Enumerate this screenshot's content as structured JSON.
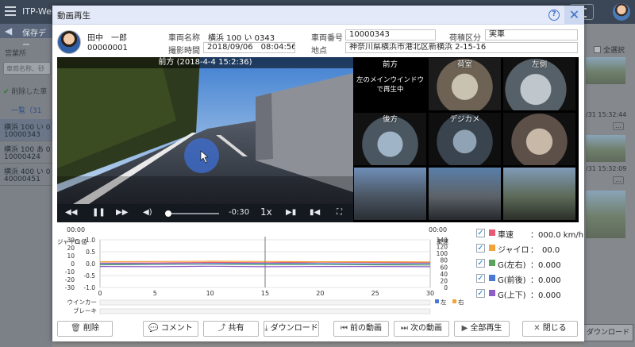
{
  "background": {
    "app_title": "ITP-Web",
    "breadcrumb": "保存デー",
    "office_label": "営業所",
    "search_placeholder": "車両名称、砂",
    "deleted_toggle": "削除した車",
    "list_header": "一覧（31",
    "list_items": [
      {
        "name": "横浜 100 い 0",
        "code": "10000343"
      },
      {
        "name": "横浜 100 あ 0",
        "code": "10000424"
      },
      {
        "name": "横浜 400 い 0",
        "code": "40000451"
      }
    ],
    "select_all": "全選択",
    "timestamps": [
      "/31 15:32:44",
      "/31 15:32:09"
    ],
    "more_label": "…",
    "download_label": "ダウンロード"
  },
  "modal": {
    "title": "動画再生",
    "help_icon": "?",
    "close_icon": "✕",
    "driver": {
      "name": "田中　一郎",
      "code": "00000001"
    },
    "fields": {
      "vehicle_name_label": "車両名称",
      "vehicle_name": "横浜 100 い 0343",
      "vehicle_number_label": "車両番号",
      "vehicle_number": "10000343",
      "cargo_label": "荷積区分",
      "cargo": "実車",
      "shot_time_label": "撮影時間",
      "shot_time": "2018/09/06　08:04:56",
      "location_label": "地点",
      "location": "神奈川県横浜市港北区新横浜 2-15-16"
    },
    "video": {
      "caption": "前方 (2018-4-4 15:2:36)",
      "time_remaining": "-0:30",
      "speed": "1x",
      "progress": 0.03
    },
    "cameras": [
      {
        "label": "前方",
        "message": "左のメインウインドウで再生中"
      },
      {
        "label": "荷室"
      },
      {
        "label": "左側"
      },
      {
        "label": "後方"
      },
      {
        "label": "デジカメ"
      },
      {
        "label": ""
      },
      {
        "label": ""
      },
      {
        "label": ""
      },
      {
        "label": ""
      }
    ],
    "legend": [
      {
        "name": "車速",
        "value": "：000.0 km/h",
        "color": "#e85a73"
      },
      {
        "name": "ジャイロ",
        "value": "：　00.0",
        "color": "#f2a33a"
      },
      {
        "name": "G(左右)",
        "value": "：0.000",
        "color": "#5aa35a"
      },
      {
        "name": "G(前後)",
        "value": "：0.000",
        "color": "#4a78d6"
      },
      {
        "name": "G(上下)",
        "value": "：0.000",
        "color": "#8e5cc6"
      }
    ],
    "buttons": {
      "delete": "削除",
      "comment": "コメント",
      "share": "共有",
      "download": "ダウンロード",
      "prev": "前の動画",
      "next": "次の動画",
      "play_all": "全部再生",
      "close": "閉じる"
    }
  },
  "chart_data": {
    "type": "line",
    "time_label": "00:00",
    "left_axis_labels": [
      "ジャイロ",
      "G 値"
    ],
    "right_axis_label": "車速",
    "x": [
      0,
      5,
      10,
      15,
      20,
      25,
      30
    ],
    "xlim": [
      0,
      30
    ],
    "gyro_ticks": [
      30,
      20,
      10,
      0,
      -10,
      -20,
      -30
    ],
    "g_ticks": [
      "1.0",
      "0.5",
      "0.0",
      "-0.5",
      "-1.0"
    ],
    "speed_ticks": [
      140,
      120,
      100,
      80,
      60,
      40,
      20,
      0
    ],
    "cursor_x": 15,
    "series": [
      {
        "name": "車速",
        "color": "#e85a73",
        "g_values": [
          0.02,
          0.03,
          0.05,
          0.04,
          0.06,
          0.05,
          0.04
        ]
      },
      {
        "name": "ジャイロ",
        "color": "#f2a33a",
        "g_values": [
          0.08,
          0.09,
          0.1,
          0.09,
          0.08,
          0.08,
          0.07
        ]
      },
      {
        "name": "G(左右)",
        "color": "#5aa35a",
        "g_values": [
          -0.05,
          -0.03,
          -0.02,
          -0.04,
          -0.03,
          -0.05,
          -0.06
        ]
      },
      {
        "name": "G(前後)",
        "color": "#4a78d6",
        "g_values": [
          0.0,
          -0.01,
          0.0,
          0.01,
          0.0,
          -0.01,
          0.0
        ]
      },
      {
        "name": "G(上下)",
        "color": "#8e5cc6",
        "g_values": [
          -0.12,
          -0.13,
          -0.11,
          -0.13,
          -0.12,
          -0.12,
          -0.13
        ]
      }
    ],
    "blinker_label": "ウインカー",
    "brake_label": "ブレーキ",
    "blinker_legend": [
      {
        "name": "左",
        "color": "#4a78d6"
      },
      {
        "name": "右",
        "color": "#f2a33a"
      }
    ]
  }
}
